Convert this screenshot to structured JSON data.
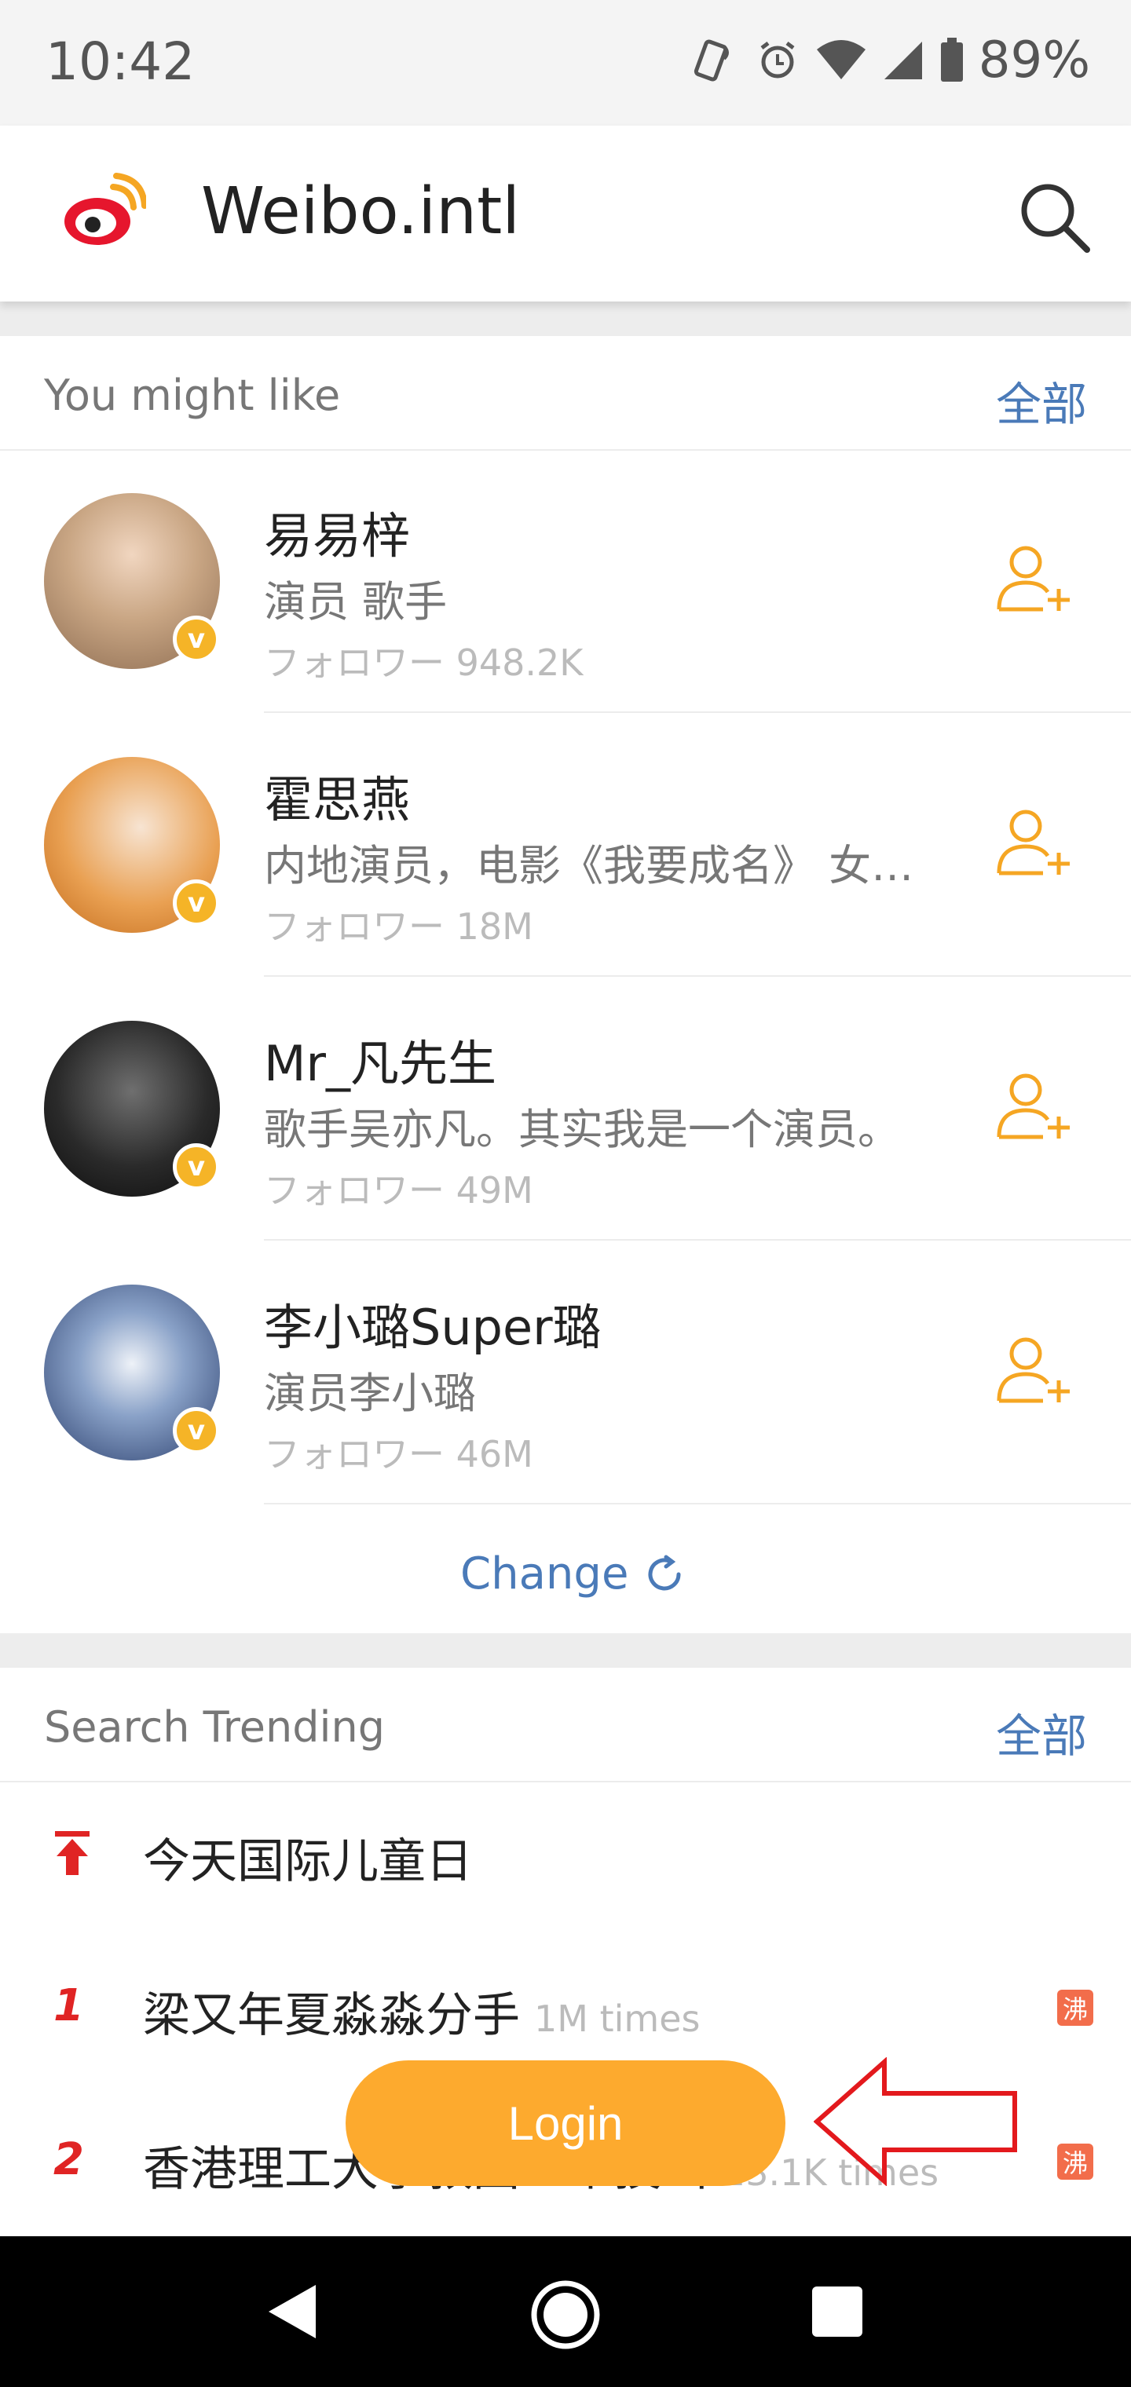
{
  "status_bar": {
    "time": "10:42",
    "battery": "89%"
  },
  "app_bar": {
    "title": "Weibo.intl",
    "logo_icon": "weibo-logo-icon",
    "search_icon": "search-icon"
  },
  "suggested": {
    "title": "You might like",
    "all_label": "全部",
    "users": [
      {
        "name": "易易梓",
        "desc": "演员 歌手",
        "followers": "フォロワー 948.2K",
        "verified": "v"
      },
      {
        "name": "霍思燕",
        "desc": "内地演员，电影《我要成名》 女…",
        "followers": "フォロワー 18M",
        "verified": "v"
      },
      {
        "name": "Mr_凡先生",
        "desc": "歌手吴亦凡。其实我是一个演员。",
        "followers": "フォロワー 49M",
        "verified": "v"
      },
      {
        "name": "李小璐Super璐",
        "desc": "演员李小璐",
        "followers": "フォロワー 46M",
        "verified": "v"
      }
    ],
    "change_label": "Change"
  },
  "trending": {
    "title": "Search Trending",
    "all_label": "全部",
    "items": [
      {
        "rank": "",
        "text": "今天国际儿童日",
        "count": "",
        "badge": ""
      },
      {
        "rank": "1",
        "text": "梁又年夏淼淼分手",
        "count": "1M times",
        "badge": "沸"
      },
      {
        "rank": "2",
        "text": "香港理工大学教团一个技出",
        "count": "23.1K times",
        "badge": "沸"
      }
    ]
  },
  "login": {
    "label": "Login"
  },
  "colors": {
    "accent": "#fdaa2e",
    "link": "#4a7ab8",
    "rank": "#e02424",
    "follow": "#f5a623"
  }
}
